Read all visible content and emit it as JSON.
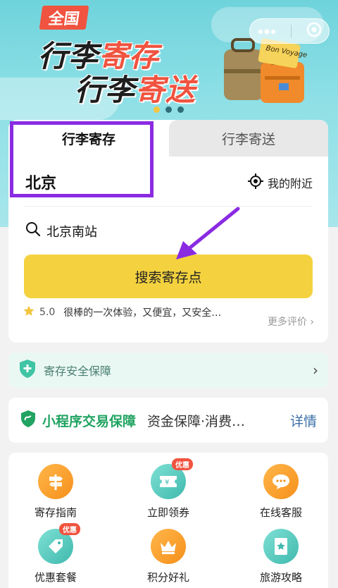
{
  "banner": {
    "tag": "全国",
    "line1_dark": "行李",
    "line1_red": "寄存",
    "line2_dark": "行李",
    "line2_red": "寄送",
    "luggage_sticker": "Bon Voyage",
    "carousel_count": 3,
    "carousel_active": 0
  },
  "capsule": {
    "more_icon": "ellipsis-icon",
    "close_icon": "target-icon"
  },
  "tabs": [
    {
      "label": "行李寄存",
      "active": true
    },
    {
      "label": "行李寄送",
      "active": false
    }
  ],
  "location": {
    "city": "北京",
    "nearby_label": "我的附近"
  },
  "search": {
    "value": "北京南站",
    "button_label": "搜索寄存点"
  },
  "review": {
    "rating": "5.0",
    "text": "很棒的一次体验，又便宜，又安全…",
    "more_label": "更多评价"
  },
  "security": {
    "label": "寄存安全保障"
  },
  "miniprogram": {
    "title": "小程序交易保障",
    "desc": "资金保障·消费…",
    "detail": "详情"
  },
  "services": [
    {
      "label": "寄存指南",
      "icon": "signpost-icon",
      "color": "orange",
      "badge": ""
    },
    {
      "label": "立即领券",
      "icon": "ticket-icon",
      "color": "teal",
      "badge": "优惠"
    },
    {
      "label": "在线客服",
      "icon": "chat-icon",
      "color": "orange",
      "badge": ""
    },
    {
      "label": "优惠套餐",
      "icon": "tag-icon",
      "color": "teal",
      "badge": "优惠"
    },
    {
      "label": "积分好礼",
      "icon": "crown-icon",
      "color": "orange",
      "badge": ""
    },
    {
      "label": "旅游攻略",
      "icon": "guidebook-icon",
      "color": "teal",
      "badge": ""
    }
  ],
  "colors": {
    "accent_yellow": "#f4d23f",
    "annotation_purple": "#8a2be2",
    "brand_green": "#21a361"
  }
}
